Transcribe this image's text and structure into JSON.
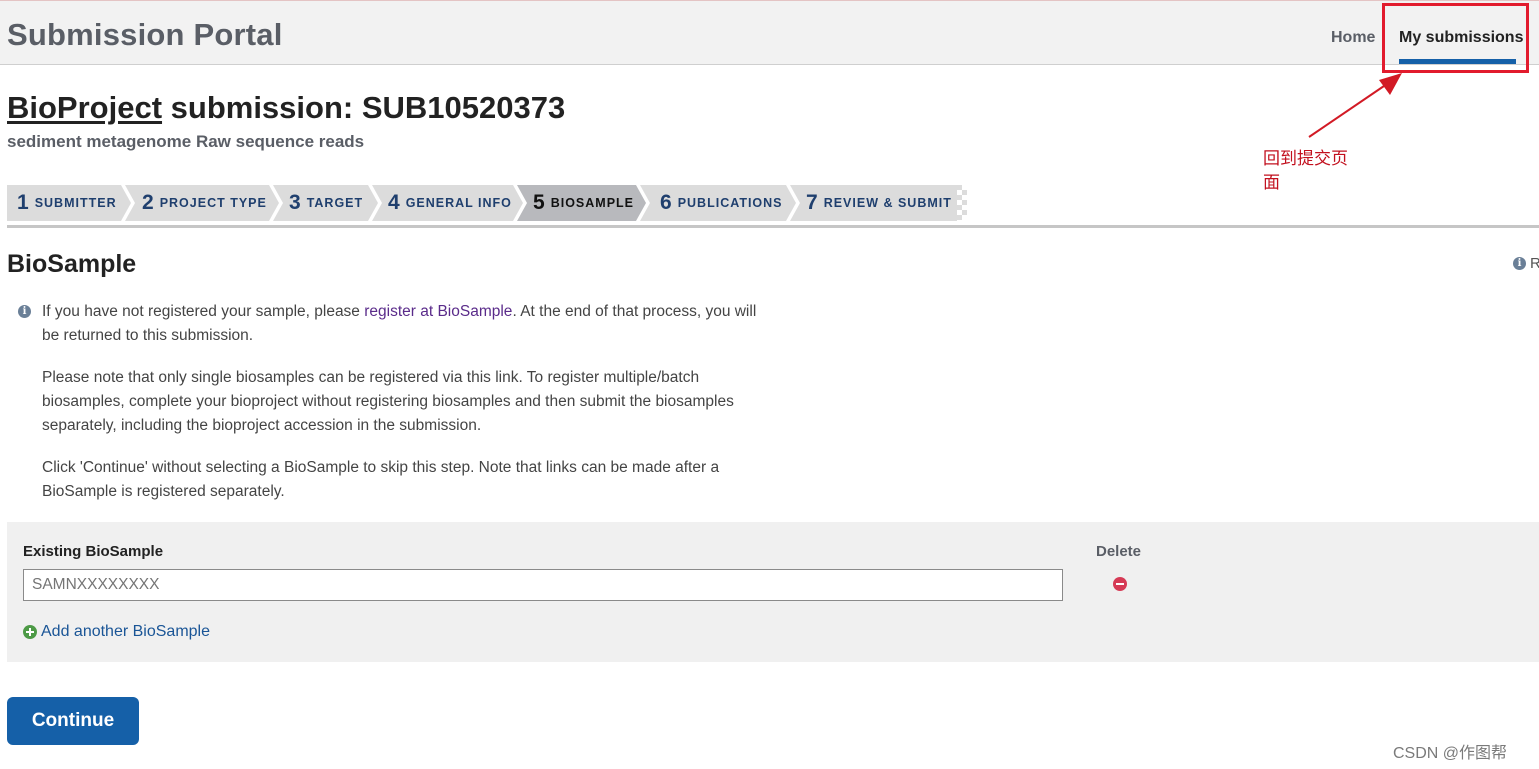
{
  "header": {
    "portal_title": "Submission Portal",
    "nav": [
      {
        "label": "Home"
      },
      {
        "label": "My submissions"
      }
    ]
  },
  "page": {
    "heading_link": "BioProject",
    "heading_rest": " submission: SUB10520373",
    "subheading": "sediment metagenome Raw sequence reads"
  },
  "annotation": {
    "text": "回到提交页面",
    "color": "#c2101e"
  },
  "steps": [
    {
      "num": "1",
      "label": "SUBMITTER"
    },
    {
      "num": "2",
      "label": "PROJECT TYPE"
    },
    {
      "num": "3",
      "label": "TARGET"
    },
    {
      "num": "4",
      "label": "GENERAL INFO"
    },
    {
      "num": "5",
      "label": "BIOSAMPLE",
      "active": true
    },
    {
      "num": "6",
      "label": "PUBLICATIONS"
    },
    {
      "num": "7",
      "label": "REVIEW & SUBMIT"
    }
  ],
  "section": {
    "title": "BioSample",
    "right_info_text": "R",
    "para1_pre": "If you have not registered your sample, please ",
    "para1_link": "register at BioSample",
    "para1_post": ". At the end of that process, you will be returned to this submission.",
    "para2": "Please note that only single biosamples can be registered via this link. To register multiple/batch biosamples, complete your bioproject without registering biosamples and then submit the biosamples separately, including the bioproject accession in the submission.",
    "para3": "Click 'Continue' without selecting a BioSample to skip this step. Note that links can be made after a BioSample is registered separately."
  },
  "form": {
    "existing_label": "Existing BioSample",
    "delete_label": "Delete",
    "input_placeholder": "SAMNXXXXXXXX",
    "input_value": "",
    "add_label": "Add another BioSample"
  },
  "continue_label": "Continue",
  "watermark": "CSDN @作图帮",
  "colors": {
    "accent": "#1560a8",
    "highlight": "#e21b2d",
    "delete": "#d63a55",
    "add": "#4d9a46"
  }
}
